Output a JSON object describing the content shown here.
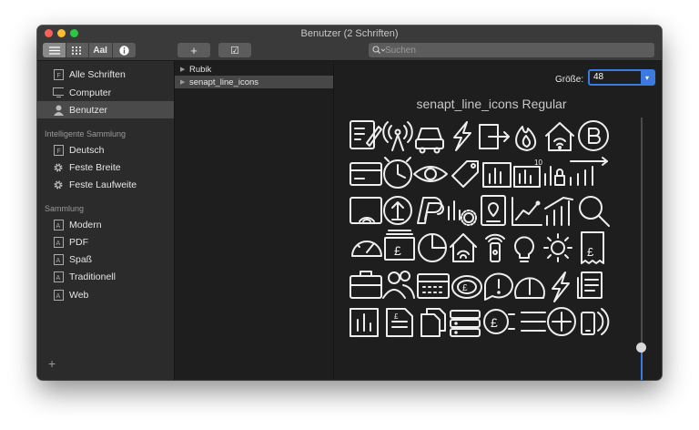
{
  "window": {
    "title": "Benutzer (2 Schriften)"
  },
  "toolbar": {
    "view_buttons": [
      "list-view",
      "grid-view",
      "AaI",
      "info"
    ],
    "add_label": "+",
    "check_label": "☑",
    "search_placeholder": "Suchen"
  },
  "sidebar": {
    "library_items": [
      {
        "label": "Alle Schriften",
        "icon": "font-file-icon"
      },
      {
        "label": "Computer",
        "icon": "monitor-icon"
      },
      {
        "label": "Benutzer",
        "icon": "user-icon",
        "selected": true
      }
    ],
    "smart_heading": "Intelligente Sammlung",
    "smart_items": [
      {
        "label": "Deutsch",
        "icon": "font-file-icon"
      },
      {
        "label": "Feste Breite",
        "icon": "gear-icon"
      },
      {
        "label": "Feste Laufweite",
        "icon": "gear-icon"
      }
    ],
    "collection_heading": "Sammlung",
    "collection_items": [
      {
        "label": "Modern",
        "icon": "font-collection-icon"
      },
      {
        "label": "PDF",
        "icon": "font-collection-icon"
      },
      {
        "label": "Spaß",
        "icon": "font-collection-icon"
      },
      {
        "label": "Traditionell",
        "icon": "font-collection-icon"
      },
      {
        "label": "Web",
        "icon": "font-collection-icon"
      }
    ],
    "add_label": "+"
  },
  "font_list": {
    "items": [
      {
        "label": "Rubik",
        "selected": false
      },
      {
        "label": "senapt_line_icons",
        "selected": true
      }
    ]
  },
  "preview": {
    "size_label": "Größe:",
    "size_value": "48",
    "font_name": "senapt_line_icons Regular",
    "slider_level": 0.16
  },
  "colors": {
    "accent": "#3b7ae0",
    "window_bg": "#1e1e1e",
    "sidebar_bg": "#2b2b2b",
    "selection": "#4a4a4a",
    "glyph_stroke": "#eeeeee"
  }
}
